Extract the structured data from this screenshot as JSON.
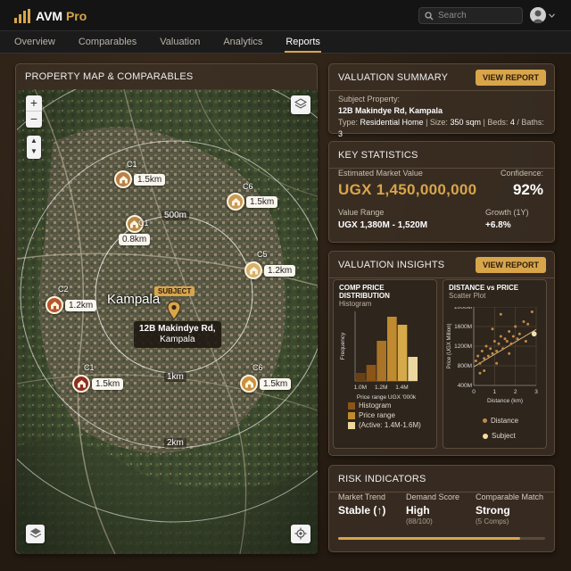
{
  "app": {
    "name_a": "AVM",
    "name_b": "Pro"
  },
  "search": {
    "placeholder": "Search"
  },
  "tabs": [
    {
      "label": "Overview",
      "active": false
    },
    {
      "label": "Comparables",
      "active": false
    },
    {
      "label": "Valuation",
      "active": false
    },
    {
      "label": "Analytics",
      "active": false
    },
    {
      "label": "Reports",
      "active": true
    }
  ],
  "map": {
    "title": "PROPERTY MAP & COMPARABLES",
    "city": "Kampala",
    "subject_tag": "SUBJECT",
    "subject_address_1": "12B Makindye Rd,",
    "subject_address_2": "Kampala",
    "rings": [
      "500m",
      "1km",
      "2km"
    ],
    "pins": [
      {
        "id": "C1",
        "dist": "1.5km",
        "color": "#b8804a"
      },
      {
        "id": "C6",
        "dist": "1.5km",
        "color": "#c99a55"
      },
      {
        "id": "C1",
        "dist": "0.8km",
        "color": "#b88a4a"
      },
      {
        "id": "C5",
        "dist": "1.2km",
        "color": "#d9b06a"
      },
      {
        "id": "C2",
        "dist": "1.2km",
        "color": "#b5562e"
      },
      {
        "id": "C1",
        "dist": "1.5km",
        "color": "#8e2e22"
      },
      {
        "id": "C6",
        "dist": "1.5km",
        "color": "#c99040"
      }
    ]
  },
  "valuation_summary": {
    "title": "VALUATION SUMMARY",
    "button": "VIEW REPORT",
    "subject_label": "Subject Property:",
    "address": "12B Makindye Rd, Kampala",
    "type_label": "Type:",
    "type_value": "Residential Home",
    "size_label": "Size:",
    "size_value": "350 sqm",
    "beds_label": "Beds:",
    "beds_value": "4",
    "baths_label": "Baths:",
    "baths_value": "3"
  },
  "key_stats": {
    "title": "KEY STATISTICS",
    "emv_label": "Estimated Market Value",
    "emv_value": "UGX 1,450,000,000",
    "conf_label": "Confidence:",
    "conf_value": "92%",
    "range_label": "Value Range",
    "range_value": "UGX 1,380M - 1,520M",
    "growth_label": "Growth (1Y)",
    "growth_value": "+6.8%"
  },
  "insights": {
    "title": "VALUATION INSIGHTS",
    "button": "VIEW REPORT"
  },
  "chart_data": [
    {
      "type": "bar",
      "title": "COMP PRICE DISTRIBUTION",
      "subtitle": "Histogram",
      "xlabel": "Price range UGX '000k",
      "ylabel": "Frequency",
      "x_ticks": [
        "1.0M",
        "1.2M",
        "1.4M"
      ],
      "categories": [
        "1.0M",
        "1.1M",
        "1.2M",
        "1.3M",
        "1.4M",
        "1.5M"
      ],
      "values": [
        1,
        2,
        5,
        8,
        7,
        3
      ],
      "bar_colors": [
        "#6b3f14",
        "#8c5518",
        "#a97425",
        "#c08a2e",
        "#d6a94a",
        "#ecd79e"
      ],
      "legend": [
        "Histogram",
        "Price range",
        "(Active: 1.4M-1.6M)"
      ],
      "legend_colors": [
        "#8c5518",
        "#c08a2e",
        "#ecd79e"
      ]
    },
    {
      "type": "scatter",
      "title": "DISTANCE vs PRICE",
      "subtitle": "Scatter Plot",
      "xlabel": "Distance (km)",
      "ylabel": "Price (UGX Million)",
      "x_ticks": [
        0,
        1,
        2,
        3
      ],
      "y_ticks": [
        "400M",
        "800M",
        "1200M",
        "1600M",
        "2000M"
      ],
      "xlim": [
        0,
        3
      ],
      "ylim": [
        400,
        2000
      ],
      "series": [
        {
          "name": "Distance",
          "color": "#c08a4a",
          "points": [
            [
              0.1,
              900
            ],
            [
              0.2,
              1000
            ],
            [
              0.3,
              850
            ],
            [
              0.4,
              1100
            ],
            [
              0.5,
              950
            ],
            [
              0.6,
              1200
            ],
            [
              0.7,
              1000
            ],
            [
              0.8,
              1150
            ],
            [
              0.9,
              1050
            ],
            [
              1.0,
              1300
            ],
            [
              1.1,
              1100
            ],
            [
              1.2,
              1250
            ],
            [
              1.3,
              1400
            ],
            [
              1.4,
              1150
            ],
            [
              1.5,
              1350
            ],
            [
              1.6,
              1300
            ],
            [
              1.7,
              1500
            ],
            [
              1.8,
              1250
            ],
            [
              1.9,
              1400
            ],
            [
              2.0,
              1600
            ],
            [
              2.1,
              1350
            ],
            [
              2.2,
              1450
            ],
            [
              2.4,
              1700
            ],
            [
              2.6,
              1650
            ],
            [
              0.9,
              1550
            ],
            [
              1.7,
              1050
            ],
            [
              0.3,
              650
            ],
            [
              0.5,
              700
            ],
            [
              1.3,
              1850
            ],
            [
              2.5,
              1300
            ],
            [
              1.1,
              850
            ],
            [
              2.8,
              1900
            ]
          ]
        },
        {
          "name": "Subject",
          "color": "#f5dea0",
          "points": [
            [
              2.9,
              1450
            ]
          ]
        }
      ],
      "trend": [
        [
          0.0,
          780
        ],
        [
          3.0,
          1540
        ]
      ],
      "legend": [
        "Distance",
        "Subject"
      ]
    }
  ],
  "risk": {
    "title": "RISK INDICATORS",
    "trend_label": "Market Trend",
    "trend_value": "Stable (↑)",
    "demand_label": "Demand Score",
    "demand_value": "High",
    "demand_sub": "(88/100)",
    "match_label": "Comparable Match",
    "match_value": "Strong",
    "match_sub": "(5 Comps)",
    "progress": 0.88
  }
}
